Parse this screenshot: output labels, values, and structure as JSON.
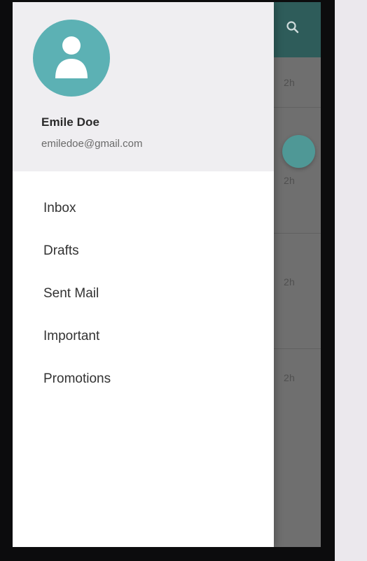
{
  "profile": {
    "name": "Emile Doe",
    "email": "emiledoe@gmail.com"
  },
  "nav": {
    "items": [
      {
        "label": "Inbox"
      },
      {
        "label": "Drafts"
      },
      {
        "label": "Sent Mail"
      },
      {
        "label": "Important"
      },
      {
        "label": "Promotions"
      }
    ]
  },
  "background_list": {
    "times": [
      "2h",
      "2h",
      "2h",
      "2h"
    ]
  },
  "icons": {
    "avatar": "person-icon",
    "search": "search-icon",
    "fab": "compose-icon"
  },
  "colors": {
    "accent": "#5cb1b4",
    "appbar": "#2e5c5a",
    "drawer_header_bg": "#efeef1"
  }
}
